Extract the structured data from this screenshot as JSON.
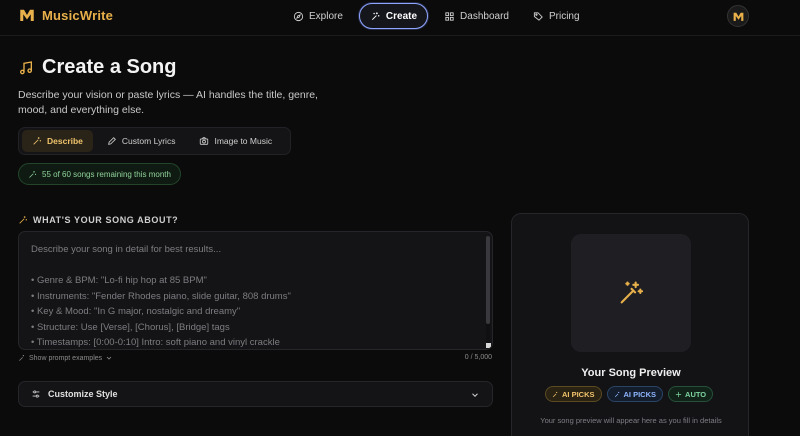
{
  "brand": {
    "name": "MusicWrite"
  },
  "nav": {
    "items": [
      {
        "label": "Explore",
        "icon": "compass-icon"
      },
      {
        "label": "Create",
        "icon": "sparkles-icon",
        "active": true
      },
      {
        "label": "Dashboard",
        "icon": "grid-icon"
      },
      {
        "label": "Pricing",
        "icon": "tag-icon"
      }
    ]
  },
  "page": {
    "title": "Create a Song",
    "subtitle": "Describe your vision or paste lyrics — AI handles the title, genre, mood, and everything else."
  },
  "modes": [
    {
      "label": "Describe",
      "icon": "magic-wand-icon",
      "active": true
    },
    {
      "label": "Custom Lyrics",
      "icon": "pencil-icon"
    },
    {
      "label": "Image to Music",
      "icon": "camera-icon"
    }
  ],
  "quota": {
    "text": "55 of 60 songs remaining this month"
  },
  "prompt": {
    "label": "WHAT'S YOUR SONG ABOUT?",
    "placeholder_lines": [
      "Describe your song in detail for best results...",
      "",
      "• Genre & BPM: \"Lo-fi hip hop at 85 BPM\"",
      "• Instruments: \"Fender Rhodes piano, slide guitar, 808 drums\"",
      "• Key & Mood: \"In G major, nostalgic and dreamy\"",
      "• Structure: Use [Verse], [Chorus], [Bridge] tags",
      "• Timestamps: [0:00-0:10] Intro: soft piano and vinyl crackle"
    ],
    "examples_link": "Show prompt examples",
    "char_count": "0 / 5,000"
  },
  "customize": {
    "label": "Customize Style"
  },
  "preview": {
    "title": "Your Song Preview",
    "badges": [
      {
        "label": "AI PICKS",
        "tone": "gold"
      },
      {
        "label": "AI PICKS",
        "tone": "blue"
      },
      {
        "label": "AUTO",
        "tone": "green"
      }
    ],
    "hint": "Your song preview will appear here as you fill in details"
  },
  "colors": {
    "background": "#0b0b0c",
    "accent": "#e8b04a",
    "active_nav_border": "#8fa6ff",
    "quota_green": "#8fd39a"
  }
}
